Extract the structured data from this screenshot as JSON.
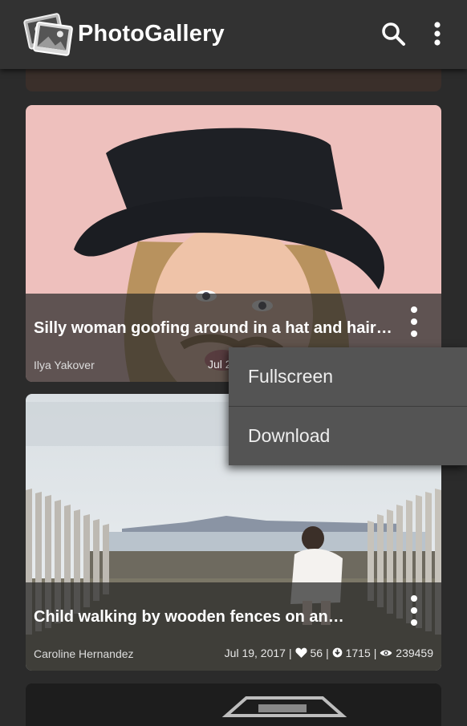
{
  "app": {
    "title": "PhotoGallery"
  },
  "toolbar": {
    "search_icon": "search-icon",
    "more_icon": "more-vertical-icon"
  },
  "cards": [
    {
      "title": "Silly woman goofing around in a hat and hair…",
      "author": "Ilya Yakover",
      "date": "Jul 2"
    },
    {
      "title": "Child walking by wooden fences on an…",
      "author": "Caroline Hernandez",
      "date": "Jul 19, 2017",
      "likes": "56",
      "downloads": "1715",
      "views": "239459"
    }
  ],
  "popup_menu": {
    "items": [
      "Fullscreen",
      "Download"
    ]
  },
  "colors": {
    "appbar": "#323232",
    "background": "#2b2b2b",
    "menu": "#545454",
    "text": "#ffffff"
  }
}
